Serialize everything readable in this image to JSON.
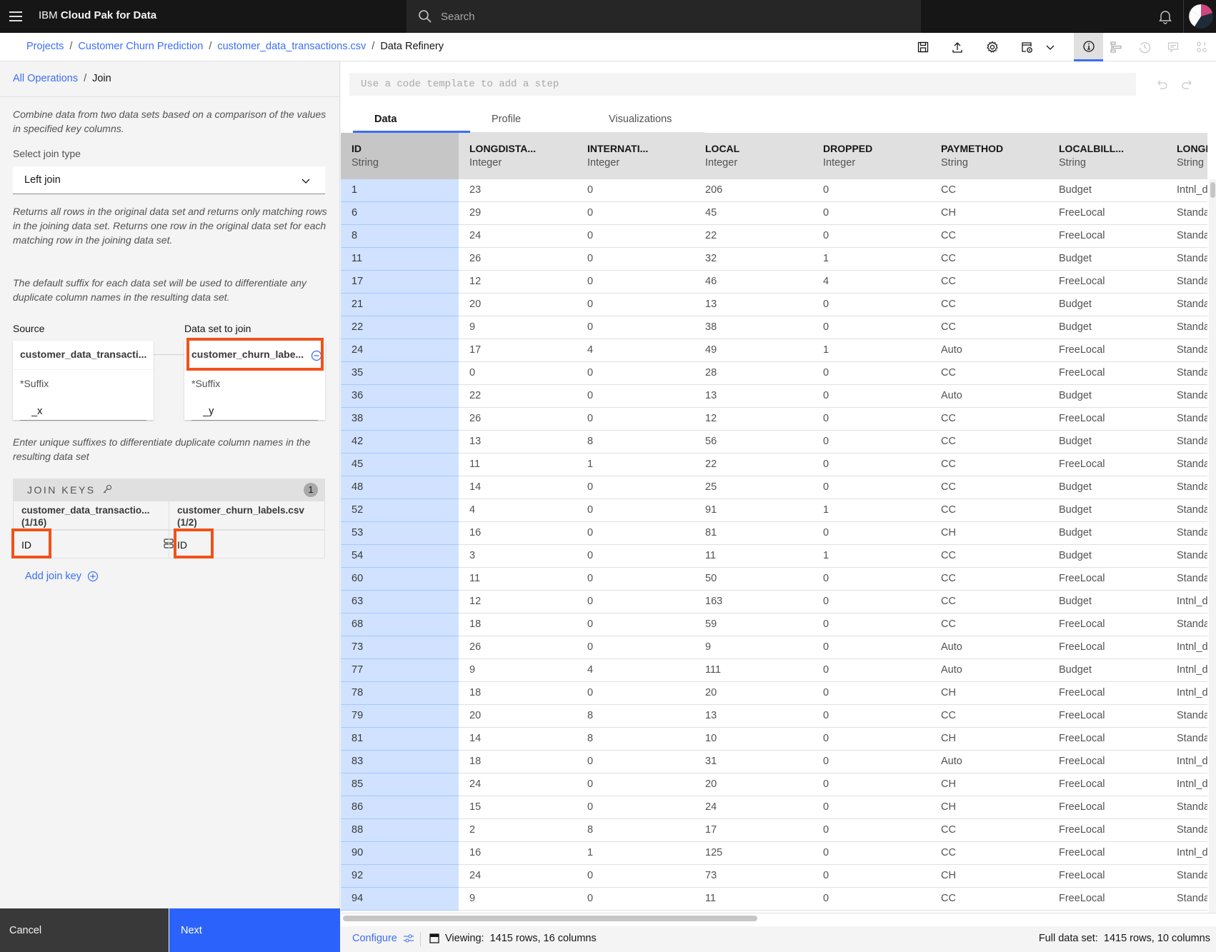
{
  "topbar": {
    "brand_prefix": "IBM",
    "brand_name": "Cloud Pak for Data",
    "search_placeholder": "Search"
  },
  "breadcrumb": {
    "items": [
      "Projects",
      "Customer Churn Prediction",
      "customer_data_transactions.csv"
    ],
    "current": "Data Refinery"
  },
  "toolbar": {
    "icons": [
      "save-icon",
      "export-icon",
      "settings-icon",
      "job-schedule-icon",
      "chevron-down-icon",
      "info-icon",
      "steps-icon",
      "history-icon",
      "comments-icon",
      "data-icon"
    ]
  },
  "left_panel": {
    "crumb_link": "All Operations",
    "crumb_current": "Join",
    "description": "Combine data from two data sets based on a comparison of the values in specified key columns.",
    "join_type_label": "Select join type",
    "join_type_value": "Left join",
    "join_type_help": "Returns all rows in the original data set and returns only matching rows in the joining data set. Returns one row in the original data set for each matching row in the joining data set.",
    "suffix_help": "The default suffix for each data set will be used to differentiate any duplicate column names in the resulting data set.",
    "source_label": "Source",
    "join_label": "Data set to join",
    "source_dataset": "customer_data_transacti...",
    "join_dataset": "customer_churn_labe...",
    "suffix_label": "*Suffix",
    "source_suffix": "_x",
    "join_suffix": "_y",
    "unique_suffix_help": "Enter unique suffixes to differentiate duplicate column names in the resulting data set",
    "join_keys": {
      "title": "JOIN KEYS",
      "count": "1",
      "left_header": "customer_data_transactio...",
      "left_count": "(1/16)",
      "right_header": "customer_churn_labels.csv",
      "right_count": "(1/2)",
      "left_key": "ID",
      "right_key": "ID"
    },
    "add_join_key": "Add join key",
    "cancel": "Cancel",
    "next": "Next"
  },
  "right_panel": {
    "code_placeholder": "Use a code template to add a step",
    "tabs": [
      "Data",
      "Profile",
      "Visualizations"
    ],
    "active_tab": "Data",
    "columns": [
      {
        "name": "ID",
        "type": "String"
      },
      {
        "name": "LONGDISTA...",
        "type": "Integer"
      },
      {
        "name": "INTERNATI...",
        "type": "Integer"
      },
      {
        "name": "LOCAL",
        "type": "Integer"
      },
      {
        "name": "DROPPED",
        "type": "Integer"
      },
      {
        "name": "PAYMETHOD",
        "type": "String"
      },
      {
        "name": "LOCALBILL...",
        "type": "String"
      },
      {
        "name": "LONGD",
        "type": "String"
      }
    ],
    "rows": [
      [
        "1",
        "23",
        "0",
        "206",
        "0",
        "CC",
        "Budget",
        "Intnl_d"
      ],
      [
        "6",
        "29",
        "0",
        "45",
        "0",
        "CH",
        "FreeLocal",
        "Standa"
      ],
      [
        "8",
        "24",
        "0",
        "22",
        "0",
        "CC",
        "FreeLocal",
        "Standa"
      ],
      [
        "11",
        "26",
        "0",
        "32",
        "1",
        "CC",
        "Budget",
        "Standa"
      ],
      [
        "17",
        "12",
        "0",
        "46",
        "4",
        "CC",
        "FreeLocal",
        "Standa"
      ],
      [
        "21",
        "20",
        "0",
        "13",
        "0",
        "CC",
        "Budget",
        "Standa"
      ],
      [
        "22",
        "9",
        "0",
        "38",
        "0",
        "CC",
        "Budget",
        "Standa"
      ],
      [
        "24",
        "17",
        "4",
        "49",
        "1",
        "Auto",
        "FreeLocal",
        "Standa"
      ],
      [
        "35",
        "0",
        "0",
        "28",
        "0",
        "CC",
        "FreeLocal",
        "Standa"
      ],
      [
        "36",
        "22",
        "0",
        "13",
        "0",
        "Auto",
        "Budget",
        "Standa"
      ],
      [
        "38",
        "26",
        "0",
        "12",
        "0",
        "CC",
        "FreeLocal",
        "Standa"
      ],
      [
        "42",
        "13",
        "8",
        "56",
        "0",
        "CC",
        "Budget",
        "Standa"
      ],
      [
        "45",
        "11",
        "1",
        "22",
        "0",
        "CC",
        "FreeLocal",
        "Standa"
      ],
      [
        "48",
        "14",
        "0",
        "25",
        "0",
        "CC",
        "Budget",
        "Standa"
      ],
      [
        "52",
        "4",
        "0",
        "91",
        "1",
        "CC",
        "Budget",
        "Standa"
      ],
      [
        "53",
        "16",
        "0",
        "81",
        "0",
        "CH",
        "Budget",
        "Standa"
      ],
      [
        "54",
        "3",
        "0",
        "11",
        "1",
        "CC",
        "Budget",
        "Standa"
      ],
      [
        "60",
        "11",
        "0",
        "50",
        "0",
        "CC",
        "FreeLocal",
        "Standa"
      ],
      [
        "63",
        "12",
        "0",
        "163",
        "0",
        "CC",
        "Budget",
        "Intnl_d"
      ],
      [
        "68",
        "18",
        "0",
        "59",
        "0",
        "CC",
        "FreeLocal",
        "Standa"
      ],
      [
        "73",
        "26",
        "0",
        "9",
        "0",
        "Auto",
        "FreeLocal",
        "Intnl_d"
      ],
      [
        "77",
        "9",
        "4",
        "111",
        "0",
        "Auto",
        "Budget",
        "Intnl_d"
      ],
      [
        "78",
        "18",
        "0",
        "20",
        "0",
        "CH",
        "FreeLocal",
        "Intnl_d"
      ],
      [
        "79",
        "20",
        "8",
        "13",
        "0",
        "CC",
        "FreeLocal",
        "Standa"
      ],
      [
        "81",
        "14",
        "8",
        "10",
        "0",
        "CH",
        "FreeLocal",
        "Standa"
      ],
      [
        "83",
        "18",
        "0",
        "31",
        "0",
        "Auto",
        "FreeLocal",
        "Intnl_d"
      ],
      [
        "85",
        "24",
        "0",
        "20",
        "0",
        "CH",
        "FreeLocal",
        "Intnl_d"
      ],
      [
        "86",
        "15",
        "0",
        "24",
        "0",
        "CH",
        "FreeLocal",
        "Standa"
      ],
      [
        "88",
        "2",
        "8",
        "17",
        "0",
        "CC",
        "FreeLocal",
        "Standa"
      ],
      [
        "90",
        "16",
        "1",
        "125",
        "0",
        "CC",
        "FreeLocal",
        "Intnl_d"
      ],
      [
        "92",
        "24",
        "0",
        "73",
        "0",
        "CH",
        "FreeLocal",
        "Standa"
      ],
      [
        "94",
        "9",
        "0",
        "11",
        "0",
        "CC",
        "FreeLocal",
        "Standa"
      ]
    ],
    "footer": {
      "configure": "Configure",
      "viewing": "Viewing:  1415 rows, 16 columns",
      "full_dataset": "Full data set:  1415 rows, 10 columns"
    }
  },
  "colors": {
    "accent": "#3d6ef5",
    "next_button": "#2b62fb",
    "highlight": "#f0521a",
    "id_column": "#d0e2ff"
  }
}
